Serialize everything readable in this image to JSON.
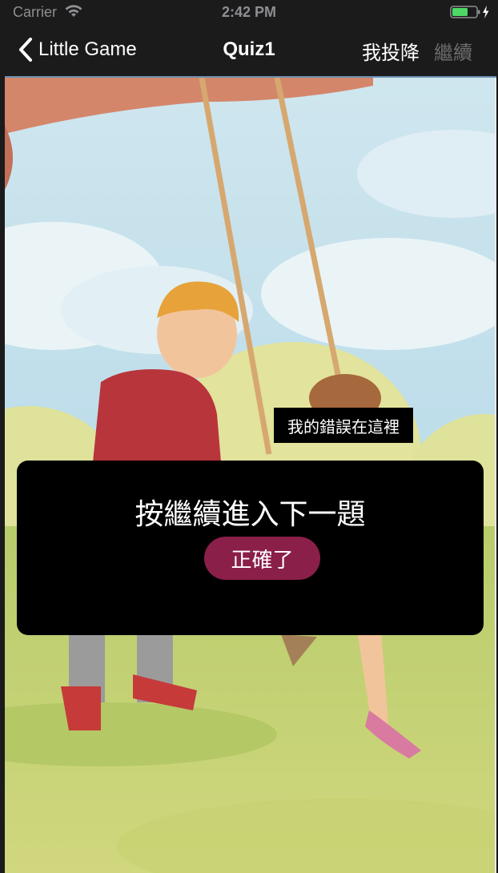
{
  "status_bar": {
    "carrier": "Carrier",
    "time": "2:42 PM",
    "wifi_icon": "wifi-icon",
    "battery_icon": "battery-charging-icon",
    "battery_color": "#4cd964"
  },
  "nav_bar": {
    "back_label": "Little Game",
    "back_icon": "chevron-left-icon",
    "title": "Quiz1",
    "surrender_label": "我投降",
    "continue_label": "繼續"
  },
  "scene": {
    "error_marker_label": "我的錯誤在這裡"
  },
  "dialog": {
    "message": "按繼續進入下一題",
    "result_label": "正確了",
    "badge_color": "#8a1f4a"
  }
}
